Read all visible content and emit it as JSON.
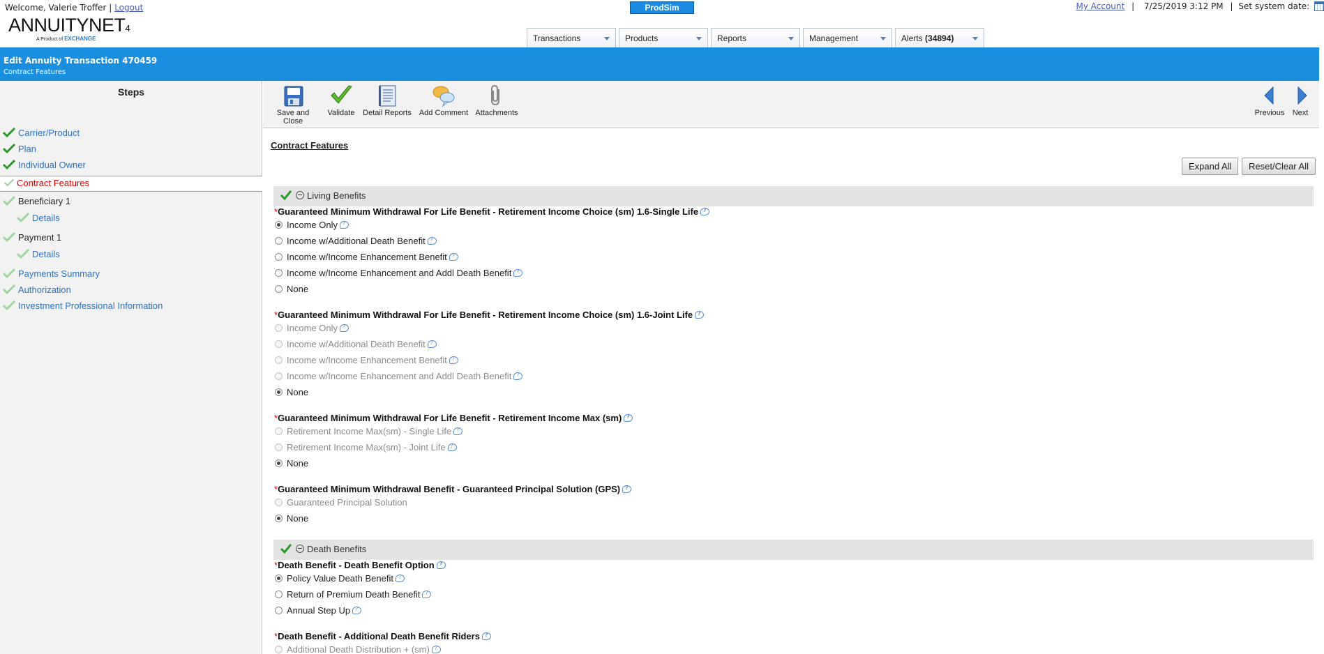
{
  "header": {
    "welcome_prefix": "Welcome, Valerie Troffer |",
    "logout": "Logout",
    "logo_main": "ANNUITYNET",
    "logo_sup": "4",
    "logo_sub": "A Product of",
    "logo_brand": "EXCHANGE",
    "environment": "ProdSim",
    "my_account": "My Account",
    "datetime": "7/25/2019 3:12 PM",
    "set_system_date": "Set system date:"
  },
  "nav": [
    {
      "label": "Transactions",
      "count": ""
    },
    {
      "label": "Products",
      "count": ""
    },
    {
      "label": "Reports",
      "count": ""
    },
    {
      "label": "Management",
      "count": ""
    },
    {
      "label": "Alerts",
      "count": "(34894)"
    }
  ],
  "title": {
    "main": "Edit Annuity Transaction 470459",
    "sub": "Contract Features"
  },
  "steps": {
    "title": "Steps",
    "items": [
      {
        "label": "Carrier/Product",
        "status": "complete"
      },
      {
        "label": "Plan",
        "status": "complete"
      },
      {
        "label": "Individual Owner",
        "status": "complete"
      },
      {
        "label": "Contract Features",
        "status": "current"
      },
      {
        "label": "Beneficiary 1",
        "status": "pending"
      },
      {
        "label": "Details",
        "status": "pending"
      },
      {
        "label": "Payment 1",
        "status": "pending"
      },
      {
        "label": "Details",
        "status": "pending"
      },
      {
        "label": "Payments Summary",
        "status": "pending"
      },
      {
        "label": "Authorization",
        "status": "pending"
      },
      {
        "label": "Investment Professional Information",
        "status": "pending"
      }
    ]
  },
  "toolbar": {
    "save_close": "Save and Close",
    "validate": "Validate",
    "detail_reports": "Detail Reports",
    "add_comment": "Add Comment",
    "attachments": "Attachments",
    "previous": "Previous",
    "next": "Next"
  },
  "content": {
    "section_title": "Contract Features",
    "expand_all": "Expand All",
    "reset_clear_all": "Reset/Clear All",
    "groups": [
      {
        "label": "Living Benefits"
      },
      {
        "label": "Death Benefits"
      }
    ],
    "questions": [
      {
        "label": "Guaranteed Minimum Withdrawal For Life Benefit - Retirement Income Choice (sm) 1.6-Single Life",
        "options": [
          {
            "label": "Income Only",
            "selected": true,
            "disabled": false,
            "help": true
          },
          {
            "label": "Income w/Additional Death Benefit",
            "selected": false,
            "disabled": false,
            "help": true
          },
          {
            "label": "Income w/Income Enhancement Benefit",
            "selected": false,
            "disabled": false,
            "help": true
          },
          {
            "label": "Income w/Income Enhancement and Addl Death Benefit",
            "selected": false,
            "disabled": false,
            "help": true
          },
          {
            "label": "None",
            "selected": false,
            "disabled": false,
            "help": false
          }
        ]
      },
      {
        "label": "Guaranteed Minimum Withdrawal For Life Benefit - Retirement Income Choice (sm) 1.6-Joint Life",
        "options": [
          {
            "label": "Income Only",
            "selected": false,
            "disabled": true,
            "help": true
          },
          {
            "label": "Income w/Additional Death Benefit",
            "selected": false,
            "disabled": true,
            "help": true
          },
          {
            "label": "Income w/Income Enhancement Benefit",
            "selected": false,
            "disabled": true,
            "help": true
          },
          {
            "label": "Income w/Income Enhancement and Addl Death Benefit",
            "selected": false,
            "disabled": true,
            "help": true
          },
          {
            "label": "None",
            "selected": true,
            "disabled": false,
            "help": false
          }
        ]
      },
      {
        "label": "Guaranteed Minimum Withdrawal For Life Benefit - Retirement Income Max (sm)",
        "options": [
          {
            "label": "Retirement Income Max(sm) - Single Life",
            "selected": false,
            "disabled": true,
            "help": true
          },
          {
            "label": "Retirement Income Max(sm) - Joint Life",
            "selected": false,
            "disabled": true,
            "help": true
          },
          {
            "label": "None",
            "selected": true,
            "disabled": false,
            "help": false
          }
        ]
      },
      {
        "label": "Guaranteed Minimum Withdrawal Benefit - Guaranteed Principal Solution (GPS)",
        "options": [
          {
            "label": "Guaranteed Principal Solution",
            "selected": false,
            "disabled": true,
            "help": false
          },
          {
            "label": "None",
            "selected": true,
            "disabled": false,
            "help": false
          }
        ]
      },
      {
        "label": "Death Benefit - Death Benefit Option",
        "options": [
          {
            "label": "Policy Value Death Benefit",
            "selected": true,
            "disabled": false,
            "help": true
          },
          {
            "label": "Return of Premium Death Benefit",
            "selected": false,
            "disabled": false,
            "help": true
          },
          {
            "label": "Annual Step Up",
            "selected": false,
            "disabled": false,
            "help": true
          }
        ]
      },
      {
        "label": "Death Benefit - Additional Death Benefit Riders",
        "options": [
          {
            "label": "Additional Death Distribution + (sm)",
            "selected": false,
            "disabled": true,
            "help": true
          }
        ]
      }
    ]
  }
}
